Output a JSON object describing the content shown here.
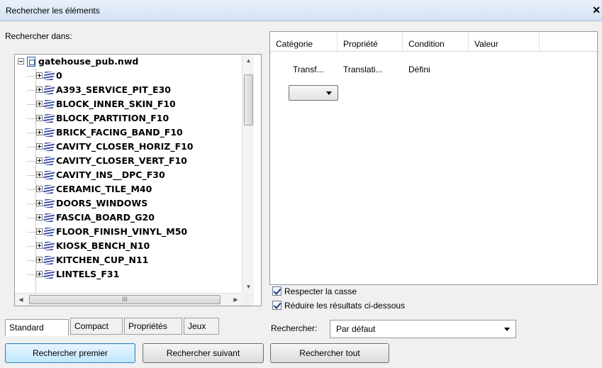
{
  "window": {
    "title": "Rechercher les éléments",
    "close_glyph": "✕"
  },
  "search_in_label": "Rechercher dans:",
  "tree": {
    "root": "gatehouse_pub.nwd",
    "items": [
      "0",
      "A393_SERVICE_PIT_E30",
      "BLOCK_INNER_SKIN_F10",
      "BLOCK_PARTITION_F10",
      "BRICK_FACING_BAND_F10",
      "CAVITY_CLOSER_HORIZ_F10",
      "CAVITY_CLOSER_VERT_F10",
      "CAVITY_INS__DPC_F30",
      "CERAMIC_TILE_M40",
      "DOORS_WINDOWS",
      "FASCIA_BOARD_G20",
      "FLOOR_FINISH_VINYL_M50",
      "KIOSK_BENCH_N10",
      "KITCHEN_CUP_N11",
      "LINTELS_F31"
    ],
    "hscroll_grip": "III"
  },
  "tabs": [
    "Standard",
    "Compact",
    "Propriétés",
    "Jeux"
  ],
  "grid": {
    "columns": [
      "Catégorie",
      "Propriété",
      "Condition",
      "Valeur"
    ],
    "rows": [
      {
        "category": "Transf...",
        "property": "Translati...",
        "condition": "Défini",
        "value": ""
      }
    ]
  },
  "options": {
    "match_case": {
      "label": "Respecter la casse",
      "checked": true
    },
    "prune_below": {
      "label": "Réduire les résultats ci-dessous",
      "checked": true
    }
  },
  "search_mode": {
    "label": "Rechercher:",
    "selected": "Par défaut"
  },
  "buttons": {
    "find_first": "Rechercher premier",
    "find_next": "Rechercher suivant",
    "find_all": "Rechercher tout"
  }
}
